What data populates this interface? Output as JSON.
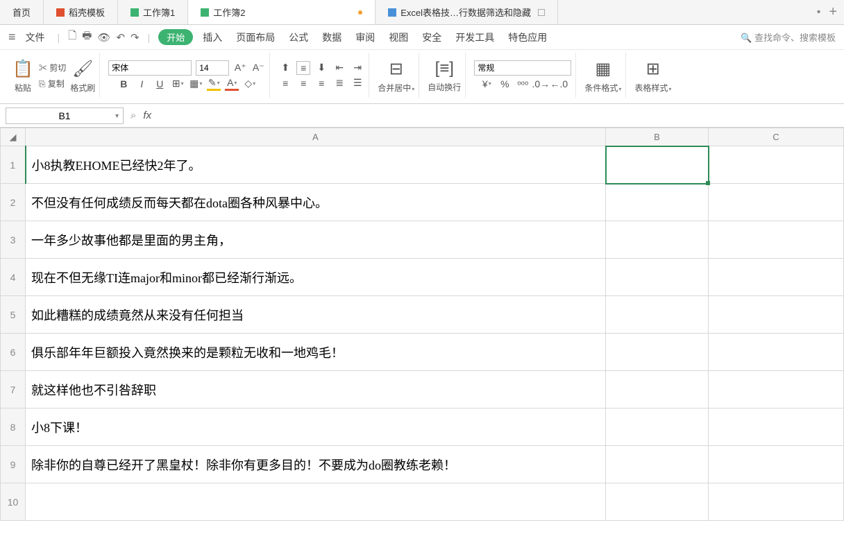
{
  "tabs": {
    "t0": "首页",
    "t1": "稻壳模板",
    "t2": "工作簿1",
    "t3": "工作簿2",
    "t4": "Excel表格技…行数据筛选和隐藏"
  },
  "menu": {
    "file": "文件",
    "start": "开始",
    "insert": "插入",
    "page": "页面布局",
    "formula": "公式",
    "data": "数据",
    "review": "审阅",
    "view": "视图",
    "security": "安全",
    "dev": "开发工具",
    "special": "特色应用",
    "search": "查找命令、搜索模板"
  },
  "ribbon": {
    "paste": "粘贴",
    "cut": "剪切",
    "copy": "复制",
    "format_painter": "格式刷",
    "font_name": "宋体",
    "font_size": "14",
    "merge": "合并居中",
    "wrap": "自动换行",
    "wrap_opt": "常规",
    "cond_fmt": "条件格式",
    "tbl_style": "表格样式"
  },
  "fbar": {
    "cell_ref": "B1",
    "fx": "fx"
  },
  "cols": {
    "A": "A",
    "B": "B",
    "C": "C"
  },
  "rows": {
    "r1": "小8执教EHOME已经快2年了。",
    "r2": "不但没有任何成绩反而每天都在dota圈各种风暴中心。",
    "r3": "一年多少故事他都是里面的男主角，",
    "r4": "现在不但无缘TI连major和minor都已经渐行渐远。",
    "r5": "如此糟糕的成绩竟然从来没有任何担当",
    "r6": "俱乐部年年巨额投入竟然换来的是颗粒无收和一地鸡毛！",
    "r7": "就这样他也不引咎辞职",
    "r8": "小8下课！",
    "r9": "除非你的自尊已经开了黑皇杖！除非你有更多目的！不要成为do圈教练老赖！",
    "r10": ""
  },
  "nums": {
    "n1": "1",
    "n2": "2",
    "n3": "3",
    "n4": "4",
    "n5": "5",
    "n6": "6",
    "n7": "7",
    "n8": "8",
    "n9": "9",
    "n10": "10"
  }
}
